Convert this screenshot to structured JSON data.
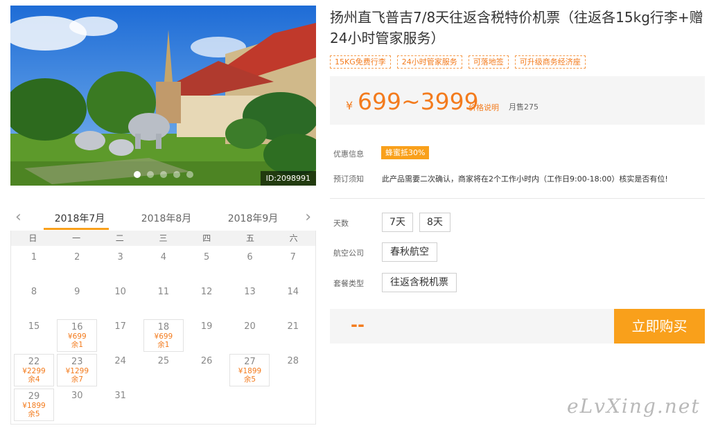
{
  "gallery": {
    "image_id": "ID:2098991",
    "dots": 5,
    "active_dot": 0
  },
  "calendar": {
    "prev_arrow": "‹",
    "next_arrow": "›",
    "months": [
      "2018年7月",
      "2018年8月",
      "2018年9月"
    ],
    "weekdays": [
      "日",
      "一",
      "二",
      "三",
      "四",
      "五",
      "六"
    ],
    "days": [
      {
        "d": "1"
      },
      {
        "d": "2"
      },
      {
        "d": "3"
      },
      {
        "d": "4"
      },
      {
        "d": "5"
      },
      {
        "d": "6"
      },
      {
        "d": "7"
      },
      {
        "d": "8"
      },
      {
        "d": "9"
      },
      {
        "d": "10"
      },
      {
        "d": "11"
      },
      {
        "d": "12"
      },
      {
        "d": "13"
      },
      {
        "d": "14"
      },
      {
        "d": "15"
      },
      {
        "d": "16",
        "price": "¥699",
        "left": "余1"
      },
      {
        "d": "17"
      },
      {
        "d": "18",
        "price": "¥699",
        "left": "余1"
      },
      {
        "d": "19"
      },
      {
        "d": "20"
      },
      {
        "d": "21"
      },
      {
        "d": "22",
        "price": "¥2299",
        "left": "余4"
      },
      {
        "d": "23",
        "price": "¥1299",
        "left": "余7"
      },
      {
        "d": "24"
      },
      {
        "d": "25"
      },
      {
        "d": "26"
      },
      {
        "d": "27",
        "price": "¥1899",
        "left": "余5"
      },
      {
        "d": "28"
      },
      {
        "d": "29",
        "price": "¥1899",
        "left": "余5"
      },
      {
        "d": "30"
      },
      {
        "d": "31"
      }
    ]
  },
  "product": {
    "title": "扬州直飞普吉7/8天往返含税特价机票（往返各15kg行李+赠24小时管家服务）",
    "tags": [
      "15KG免费行李",
      "24小时管家服务",
      "可落地签",
      "可升级商务经济座"
    ],
    "price": {
      "yen": "¥",
      "range": "699~3999",
      "note": "价格说明",
      "sold": "月售275"
    },
    "promo": {
      "label": "优惠信息",
      "badge": "蜂蜜抵30%"
    },
    "booking_notice": {
      "label": "预订须知",
      "text": "此产品需要二次确认，商家将在2个工作小时内（工作日9:00-18:00）核实是否有位!"
    },
    "days_option": {
      "label": "天数",
      "options": [
        "7天",
        "8天"
      ]
    },
    "airline": {
      "label": "航空公司",
      "options": [
        "春秋航空"
      ]
    },
    "package": {
      "label": "套餐类型",
      "options": [
        "往返含税机票"
      ]
    },
    "buy": {
      "placeholder": "--",
      "button": "立即购买"
    }
  },
  "watermark": "eLvXing.net",
  "colors": {
    "accent": "#f9a01b",
    "price": "#f37b1d"
  }
}
